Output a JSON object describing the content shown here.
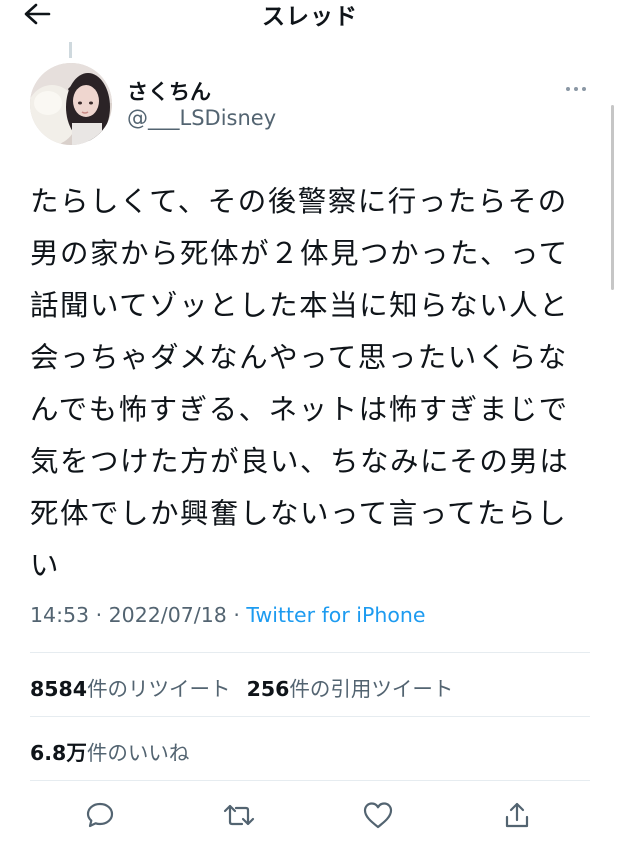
{
  "header": {
    "title": "スレッド",
    "back_icon": "arrow-left-icon"
  },
  "author": {
    "display_name": "さくちん",
    "handle": "@___LSDisney"
  },
  "tweet": {
    "text": "たらしくて、その後警察に行ったらその男の家から死体が２体見つかった、って話聞いてゾッとした本当に知らない人と会っちゃダメなんやって思ったいくらなんでも怖すぎる、ネットは怖すぎまじで気をつけた方が良い、ちなみにその男は死体でしか興奮しないって言ってたらしい"
  },
  "meta": {
    "time": "14:53",
    "separator": " · ",
    "date": "2022/07/18",
    "source": "Twitter for iPhone"
  },
  "stats": {
    "retweets_count": "8584",
    "retweets_label": "件のリツイート",
    "quotes_count": "256",
    "quotes_label": "件の引用ツイート",
    "likes_count": "6.8万",
    "likes_label": "件のいいね"
  },
  "actions": {
    "reply_icon": "comment-icon",
    "retweet_icon": "retweet-icon",
    "like_icon": "heart-icon",
    "share_icon": "share-icon"
  },
  "colors": {
    "text": "#0f1419",
    "secondary": "#536471",
    "link": "#1d9bf0",
    "divider": "#e6ecf0"
  }
}
